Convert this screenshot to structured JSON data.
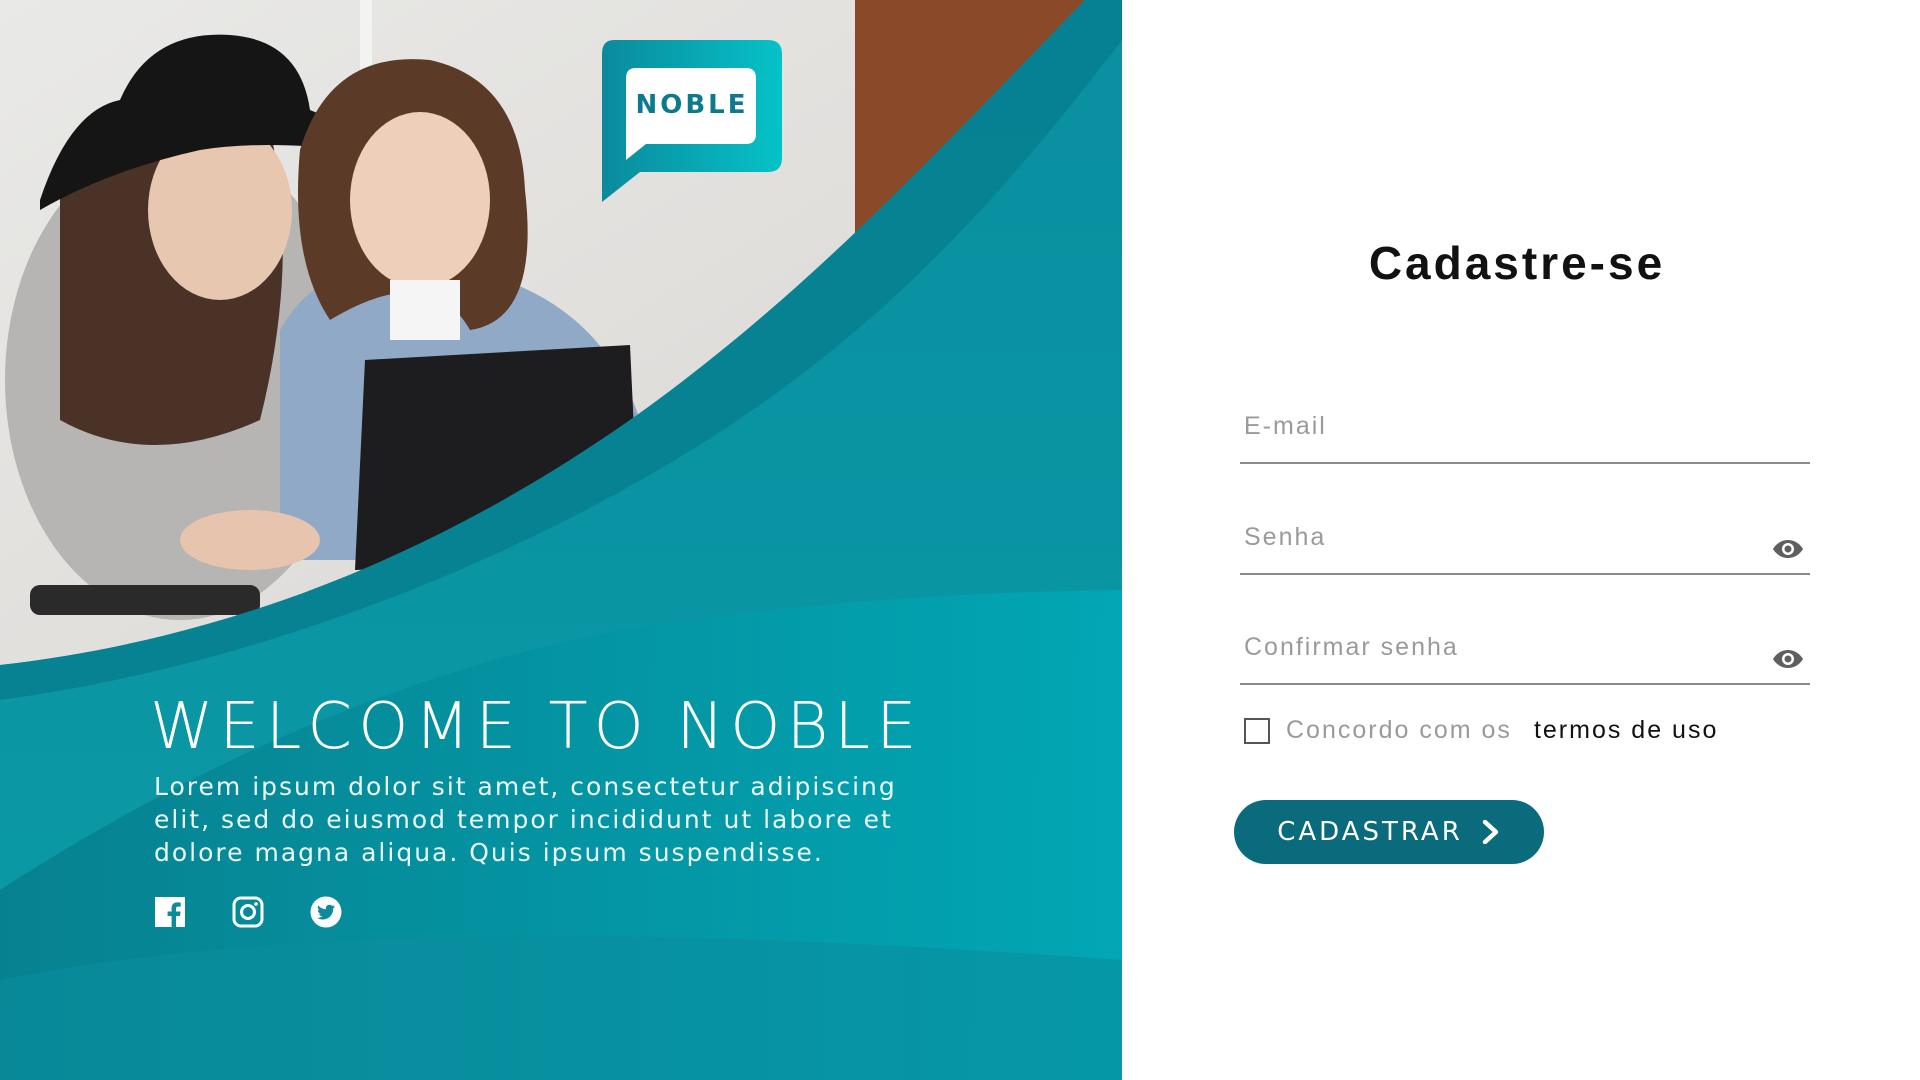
{
  "colors": {
    "brand_primary": "#0b7f93",
    "brand_dark": "#0a6b7c",
    "brand_light": "#00b3bf",
    "form_bg": "#ffffff",
    "text_dark": "#111111",
    "text_muted": "#9a9a9a"
  },
  "hero": {
    "logo_text": "NOBLE",
    "welcome_title": "WELCOME TO NOBLE",
    "intro_text": "Lorem ipsum dolor sit amet, consectetur adipiscing elit, sed do eiusmod tempor incididunt ut labore et dolore magna aliqua. Quis ipsum suspendisse.",
    "social_icons": [
      "facebook-icon",
      "instagram-icon",
      "twitter-icon"
    ]
  },
  "form": {
    "title": "Cadastre-se",
    "email": {
      "placeholder": "E-mail",
      "value": ""
    },
    "password": {
      "placeholder": "Senha",
      "value": "",
      "toggle_icon": "eye-icon"
    },
    "confirm_password": {
      "placeholder": "Confirmar senha",
      "value": "",
      "toggle_icon": "eye-icon"
    },
    "terms": {
      "checked": false,
      "text": "Concordo com os",
      "link_text": "termos de uso"
    },
    "submit_label": "CADASTRAR",
    "submit_icon": "chevron-right-icon"
  }
}
